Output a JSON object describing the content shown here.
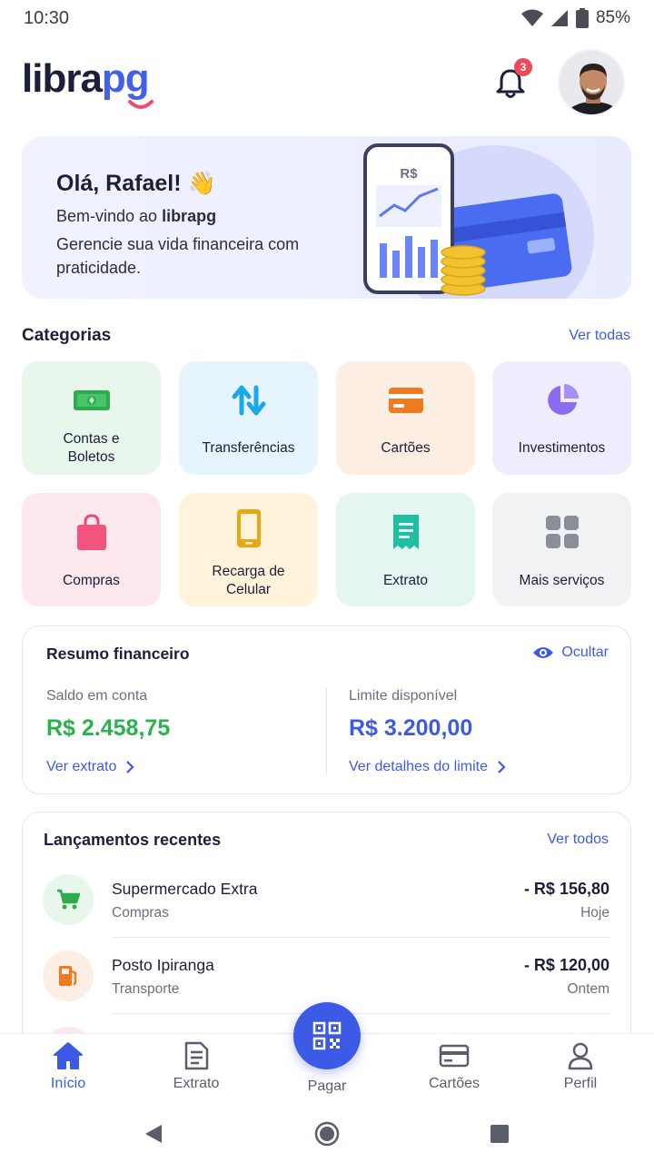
{
  "status_bar": {
    "time": "10:30",
    "battery": "85%"
  },
  "header": {
    "logo_part1": "libra",
    "logo_part2": "pg",
    "notification_count": "3"
  },
  "hero": {
    "greeting": "Olá, Rafael! 👋",
    "welcome_prefix": "Bem-vindo ao ",
    "welcome_brand": "librapg",
    "tagline": "Gerencie sua vida financeira com praticidade.",
    "card_currency": "R$"
  },
  "categories": {
    "title": "Categorias",
    "see_all": "Ver todas",
    "items": [
      {
        "label": "Contas e Boletos",
        "icon": "money-bill-icon",
        "bg": "#e9f6ec"
      },
      {
        "label": "Transferências",
        "icon": "transfer-arrows-icon",
        "bg": "#e6f5fd"
      },
      {
        "label": "Cartões",
        "icon": "credit-card-icon",
        "bg": "#fdeee4"
      },
      {
        "label": "Investimentos",
        "icon": "pie-chart-icon",
        "bg": "#efedfd"
      },
      {
        "label": "Compras",
        "icon": "shopping-bag-icon",
        "bg": "#fde8ee"
      },
      {
        "label": "Recarga de Celular",
        "icon": "smartphone-icon",
        "bg": "#fff4db"
      },
      {
        "label": "Extrato",
        "icon": "receipt-icon",
        "bg": "#e5f6f2"
      },
      {
        "label": "Mais serviços",
        "icon": "grid-icon",
        "bg": "#f1f2f4"
      }
    ]
  },
  "summary": {
    "title": "Resumo financeiro",
    "hide_label": "Ocultar",
    "balance_label": "Saldo em conta",
    "balance_value": "R$ 2.458,75",
    "balance_link": "Ver extrato",
    "limit_label": "Limite disponível",
    "limit_value": "R$ 3.200,00",
    "limit_link": "Ver detalhes do limite",
    "colors": {
      "balance": "#2bb24c",
      "limit": "#3d5ae6"
    }
  },
  "recent": {
    "title": "Lançamentos recentes",
    "see_all": "Ver todos",
    "items": [
      {
        "name": "Supermercado Extra",
        "category": "Compras",
        "amount": "- R$ 156,80",
        "when": "Hoje",
        "icon": "cart-icon"
      },
      {
        "name": "Posto Ipiranga",
        "category": "Transporte",
        "amount": "- R$ 120,00",
        "when": "Ontem",
        "icon": "fuel-pump-icon"
      }
    ]
  },
  "bottom_nav": {
    "items": [
      {
        "label": "Início",
        "icon": "home-icon",
        "active": true
      },
      {
        "label": "Extrato",
        "icon": "document-icon",
        "active": false
      },
      {
        "label": "Pagar",
        "icon": "qr-code-icon",
        "active": false
      },
      {
        "label": "Cartões",
        "icon": "card-icon",
        "active": false
      },
      {
        "label": "Perfil",
        "icon": "user-icon",
        "active": false
      }
    ]
  },
  "accent_color": "#3d5ae6"
}
